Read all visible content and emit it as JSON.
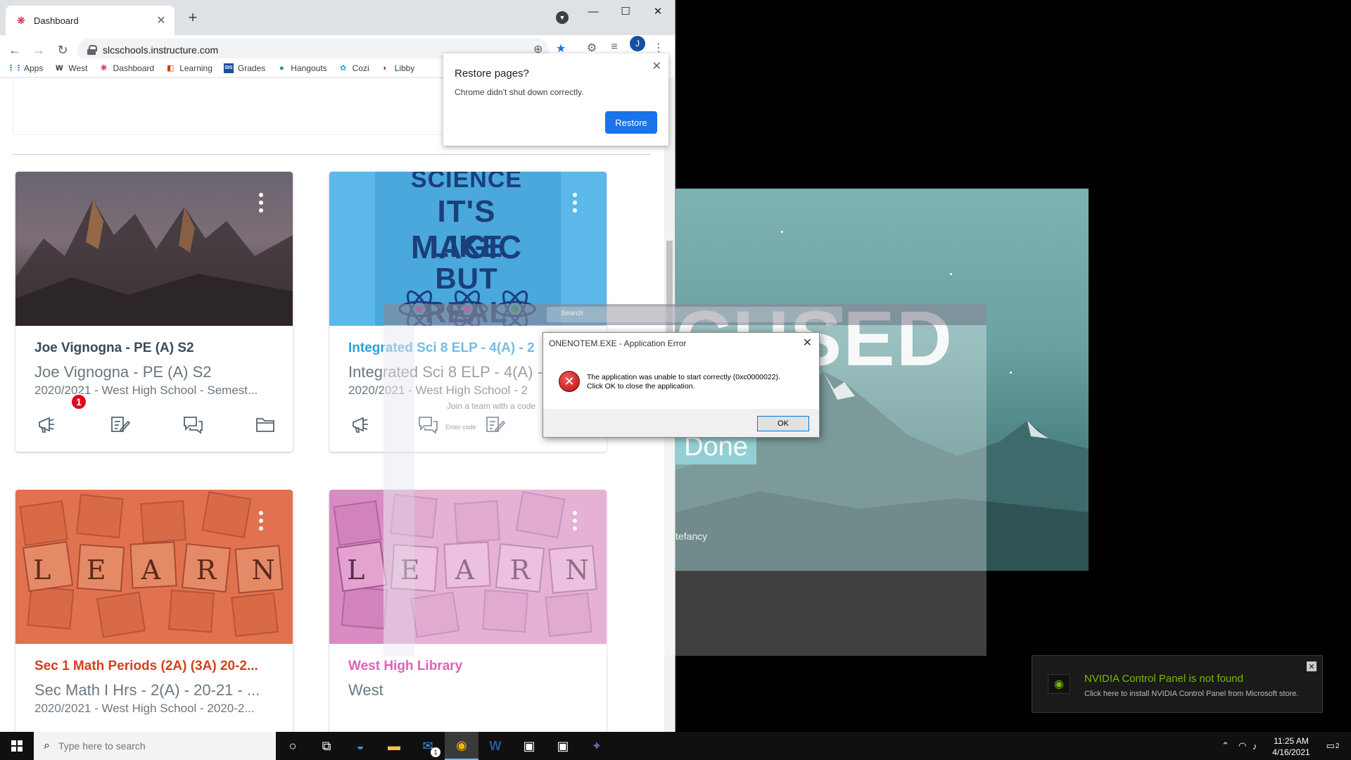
{
  "browser": {
    "tab_title": "Dashboard",
    "url": "slcschools.instructure.com",
    "avatar_initial": "J",
    "bookmarks": [
      "Apps",
      "West",
      "Dashboard",
      "Learning",
      "Grades",
      "Hangouts",
      "Cozi",
      "Libby"
    ]
  },
  "restore_popup": {
    "title": "Restore pages?",
    "message": "Chrome didn't shut down correctly.",
    "button": "Restore"
  },
  "cards": [
    {
      "title": "Joe Vignogna - PE (A) S2",
      "subtitle": "Joe Vignogna - PE (A) S2",
      "term": "2020/2021 - West High School - Semest...",
      "title_color": "#394B58",
      "badge": "1"
    },
    {
      "title": "Integrated Sci 8 ELP - 4(A) - 2",
      "subtitle": "Integrated Sci 8 ELP - 4(A) - 2",
      "term": "2020/2021 - West High School - 2",
      "title_color": "#2d9fd9",
      "hero_text": [
        "SCIENCE",
        "IT'S LIKE",
        "MAGIC",
        "BUT REAL"
      ]
    },
    {
      "title": "Sec 1 Math Periods (2A) (3A) 20-2...",
      "subtitle": "Sec Math I Hrs - 2(A) - 20-21 - ...",
      "term": "2020/2021 - West High School - 2020-2...",
      "title_color": "#d2401d",
      "hero_letters": [
        "L",
        "E",
        "A",
        "R",
        "N"
      ]
    },
    {
      "title": "West High Library",
      "subtitle": "West",
      "title_color": "#e062b9",
      "hero_letters": [
        "L",
        "E",
        "A",
        "R",
        "N"
      ]
    }
  ],
  "wallpaper": {
    "big_text": "CUSED",
    "done_text": "Done",
    "credit": "tefancy"
  },
  "ghost_app": {
    "search_placeholder": "Search",
    "join_text": "Join a team with a code",
    "code_placeholder": "Enter code"
  },
  "error_dialog": {
    "title": "ONENOTEM.EXE - Application Error",
    "message_line1": "The application was unable to start correctly (0xc0000022).",
    "message_line2": "Click OK to close the application.",
    "ok": "OK"
  },
  "nvidia_toast": {
    "title": "NVIDIA Control Panel is not found",
    "message": "Click here to install NVIDIA Control Panel from Microsoft store."
  },
  "taskbar": {
    "search_placeholder": "Type here to search",
    "time": "11:25 AM",
    "date": "4/16/2021",
    "notification_count": "2",
    "mail_badge": "1"
  }
}
